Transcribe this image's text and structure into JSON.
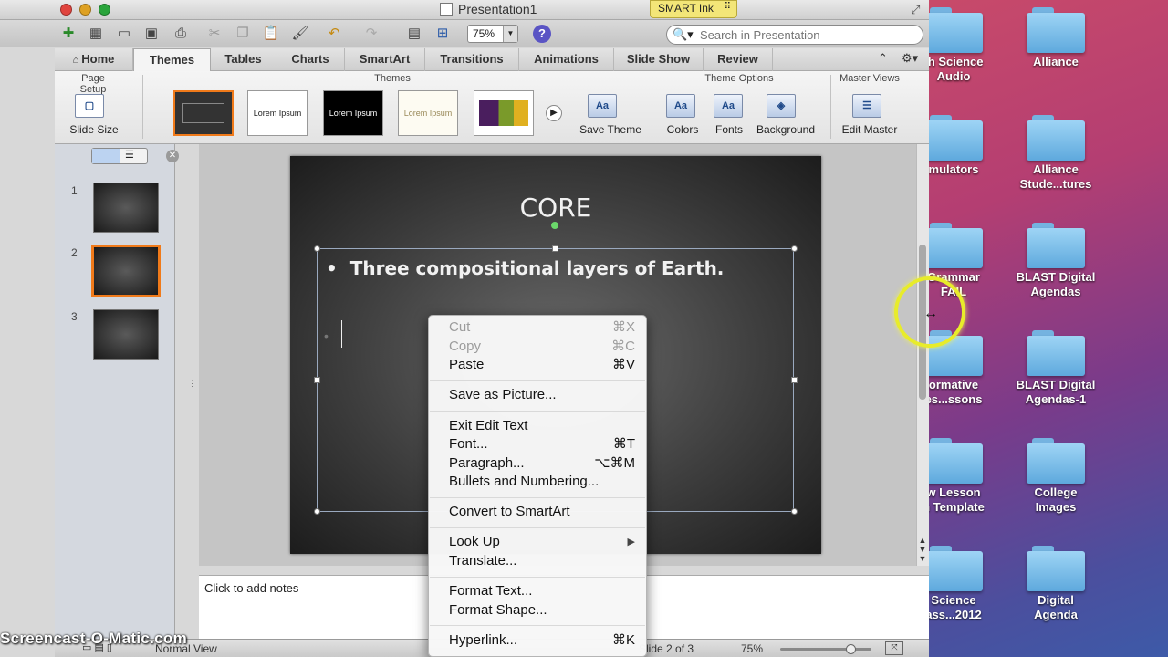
{
  "window": {
    "title": "Presentation1",
    "smart_ink": "SMART Ink"
  },
  "toolbar": {
    "zoom": "75%",
    "search_placeholder": "Search in Presentation"
  },
  "ribbon_tabs": [
    "Home",
    "Themes",
    "Tables",
    "Charts",
    "SmartArt",
    "Transitions",
    "Animations",
    "Slide Show",
    "Review"
  ],
  "ribbon": {
    "groups": {
      "page_setup": "Page Setup",
      "themes": "Themes",
      "theme_options": "Theme Options",
      "master_views": "Master Views"
    },
    "buttons": {
      "slide_size": "Slide Size",
      "save_theme": "Save Theme",
      "colors": "Colors",
      "fonts": "Fonts",
      "background": "Background",
      "edit_master": "Edit Master"
    },
    "theme_thumbs": [
      "",
      "Lorem Ipsum",
      "Lorem Ipsum",
      "Lorem Ipsum",
      ""
    ]
  },
  "slides_panel": {
    "numbers": [
      "1",
      "2",
      "3"
    ],
    "selected_index": 2
  },
  "slide": {
    "title": "CORE",
    "bullet1": "Three compositional layers of Earth."
  },
  "notes": {
    "placeholder": "Click to add notes"
  },
  "status": {
    "view": "Normal View",
    "slide_info": "Slide 2 of 3",
    "zoom": "75%"
  },
  "context_menu": {
    "items": [
      {
        "label": "Cut",
        "shortcut": "⌘X",
        "enabled": false
      },
      {
        "label": "Copy",
        "shortcut": "⌘C",
        "enabled": false
      },
      {
        "label": "Paste",
        "shortcut": "⌘V",
        "enabled": true
      },
      {
        "label": "Save as Picture...",
        "shortcut": "",
        "enabled": true
      },
      {
        "label": "Exit Edit Text",
        "shortcut": "",
        "enabled": true
      },
      {
        "label": "Font...",
        "shortcut": "⌘T",
        "enabled": true
      },
      {
        "label": "Paragraph...",
        "shortcut": "⌥⌘M",
        "enabled": true
      },
      {
        "label": "Bullets and Numbering...",
        "shortcut": "",
        "enabled": true
      },
      {
        "label": "Convert to SmartArt",
        "shortcut": "",
        "enabled": true
      },
      {
        "label": "Look Up",
        "shortcut": "▶",
        "enabled": true
      },
      {
        "label": "Translate...",
        "shortcut": "",
        "enabled": true
      },
      {
        "label": "Format Text...",
        "shortcut": "",
        "enabled": true
      },
      {
        "label": "Format Shape...",
        "shortcut": "",
        "enabled": true
      },
      {
        "label": "Hyperlink...",
        "shortcut": "⌘K",
        "enabled": true
      }
    ]
  },
  "desktop_folders": [
    "th Science\nAudio",
    "Alliance",
    "mulators",
    "Alliance\nStude...tures",
    "Grammar\nFAIL",
    "BLAST Digital\nAgendas",
    "ormative\nes...ssons",
    "BLAST Digital\nAgendas-1",
    "w Lesson\nn Template",
    "College\nImages",
    "Science\nass...2012",
    "Digital\nAgenda"
  ],
  "watermark": "Screencast-O-Matic.com",
  "colors": {
    "accent_selection": "#f07a1a",
    "highlight_ring": "#e8ec2a"
  }
}
